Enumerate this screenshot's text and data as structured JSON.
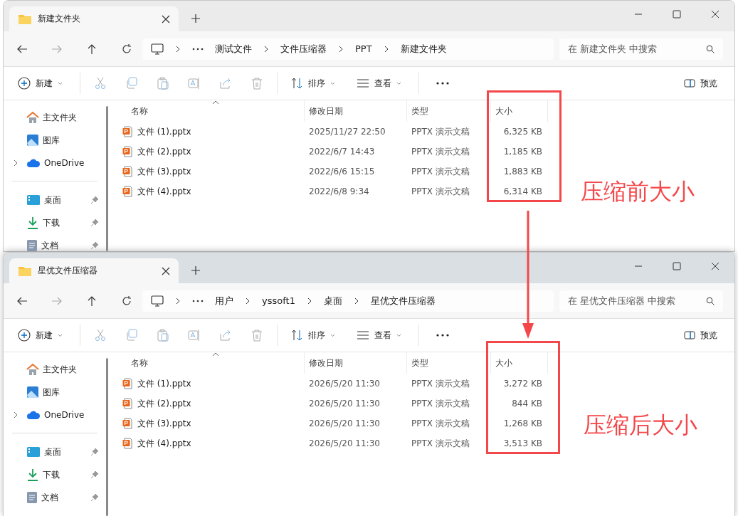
{
  "windows": [
    {
      "tab_title": "新建文件夹",
      "focused": false,
      "breadcrumb": [
        "测试文件",
        "文件压缩器",
        "PPT",
        "新建文件夹"
      ],
      "search_placeholder": "在 新建文件夹 中搜索",
      "toolbar": {
        "new": "新建",
        "sort": "排序",
        "view": "查看",
        "preview": "预览"
      },
      "sidebar": [
        {
          "label": "主文件夹",
          "kind": "home",
          "pinned": false,
          "expandable": false
        },
        {
          "label": "图库",
          "kind": "gallery",
          "pinned": false,
          "expandable": false
        },
        {
          "label": "OneDrive",
          "kind": "cloud",
          "pinned": false,
          "expandable": true
        },
        {
          "label": "桌面",
          "kind": "desktop",
          "pinned": true,
          "expandable": false
        },
        {
          "label": "下载",
          "kind": "download",
          "pinned": true,
          "expandable": false
        },
        {
          "label": "文档",
          "kind": "documents",
          "pinned": true,
          "expandable": false
        }
      ],
      "columns": [
        "名称",
        "修改日期",
        "类型",
        "大小"
      ],
      "files": [
        {
          "name": "文件 (1).pptx",
          "modified": "2025/11/27 22:50",
          "type": "PPTX 演示文稿",
          "size": "6,325 KB"
        },
        {
          "name": "文件 (2).pptx",
          "modified": "2022/6/7 14:43",
          "type": "PPTX 演示文稿",
          "size": "1,185 KB"
        },
        {
          "name": "文件 (3).pptx",
          "modified": "2022/6/6 15:15",
          "type": "PPTX 演示文稿",
          "size": "1,883 KB"
        },
        {
          "name": "文件 (4).pptx",
          "modified": "2022/6/8 9:34",
          "type": "PPTX 演示文稿",
          "size": "6,314 KB"
        }
      ]
    },
    {
      "tab_title": "星优文件压缩器",
      "focused": true,
      "breadcrumb": [
        "用户",
        "yssoft1",
        "桌面",
        "星优文件压缩器"
      ],
      "search_placeholder": "在 星优文件压缩器 中搜索",
      "toolbar": {
        "new": "新建",
        "sort": "排序",
        "view": "查看",
        "preview": "预览"
      },
      "sidebar": [
        {
          "label": "主文件夹",
          "kind": "home",
          "pinned": false,
          "expandable": false
        },
        {
          "label": "图库",
          "kind": "gallery",
          "pinned": false,
          "expandable": false
        },
        {
          "label": "OneDrive",
          "kind": "cloud",
          "pinned": false,
          "expandable": true
        },
        {
          "label": "桌面",
          "kind": "desktop",
          "pinned": true,
          "expandable": false
        },
        {
          "label": "下载",
          "kind": "download",
          "pinned": true,
          "expandable": false
        },
        {
          "label": "文档",
          "kind": "documents",
          "pinned": true,
          "expandable": false
        }
      ],
      "columns": [
        "名称",
        "修改日期",
        "类型",
        "大小"
      ],
      "files": [
        {
          "name": "文件 (1).pptx",
          "modified": "2026/5/20 11:30",
          "type": "PPTX 演示文稿",
          "size": "3,272 KB"
        },
        {
          "name": "文件 (2).pptx",
          "modified": "2026/5/20 11:30",
          "type": "PPTX 演示文稿",
          "size": "844 KB"
        },
        {
          "name": "文件 (3).pptx",
          "modified": "2026/5/20 11:30",
          "type": "PPTX 演示文稿",
          "size": "1,268 KB"
        },
        {
          "name": "文件 (4).pptx",
          "modified": "2026/5/20 11:30",
          "type": "PPTX 演示文稿",
          "size": "3,513 KB"
        }
      ]
    }
  ],
  "annotations": [
    {
      "label": "压缩前大小"
    },
    {
      "label": "压缩后大小"
    }
  ]
}
